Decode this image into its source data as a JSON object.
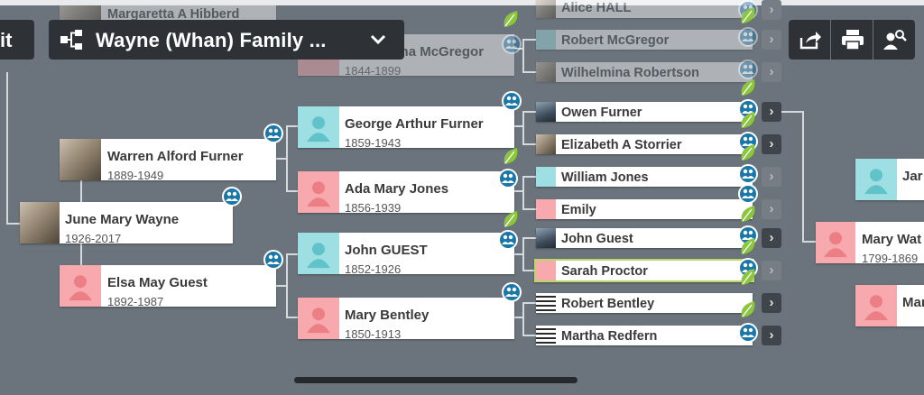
{
  "header": {
    "back_label": "it",
    "tree_title": "Wayne (Whan) Family ...",
    "icons": [
      "tree-view-icon",
      "chevron-down-icon",
      "share-icon",
      "print-icon",
      "person-search-icon"
    ]
  },
  "colors": {
    "male": "#9edfe3",
    "female": "#f7a9ad",
    "badge": "#1a77a7",
    "leaf": "#8cc63f",
    "toolbar": "#2e3237"
  },
  "people": {
    "june": {
      "name": "June Mary Wayne",
      "dates": "1926-2017"
    },
    "warren": {
      "name": "Warren Alford Furner",
      "dates": "1889-1949"
    },
    "elsa": {
      "name": "Elsa May Guest",
      "dates": "1892-1987"
    },
    "george": {
      "name": "George Arthur Furner",
      "dates": "1859-1943"
    },
    "ada": {
      "name": "Ada Mary Jones",
      "dates": "1856-1939"
    },
    "john": {
      "name": "John GUEST",
      "dates": "1852-1926"
    },
    "maryb": {
      "name": "Mary Bentley",
      "dates": "1850-1913"
    },
    "margaretta": {
      "name": "Margaretta A Hibberd"
    },
    "wilhelmina_top": {
      "name": "Wilhelmina McGregor",
      "dates": "1844-1899"
    },
    "alice": {
      "name": "Alice HALL"
    },
    "robertmc": {
      "name": "Robert McGregor"
    },
    "wilhelmina": {
      "name": "Wilhelmina Robertson"
    },
    "owen": {
      "name": "Owen Furner"
    },
    "elizabeth": {
      "name": "Elizabeth A Storrier"
    },
    "william": {
      "name": "William Jones"
    },
    "emily": {
      "name": "Emily"
    },
    "johng": {
      "name": "John Guest"
    },
    "sarah": {
      "name": "Sarah Proctor"
    },
    "robertb": {
      "name": "Robert Bentley"
    },
    "martha": {
      "name": "Martha Redfern"
    },
    "jar": {
      "name": "Jar"
    },
    "marywat": {
      "name": "Mary Wat",
      "dates": "1799-1869"
    },
    "mar": {
      "name": "Mar"
    }
  }
}
